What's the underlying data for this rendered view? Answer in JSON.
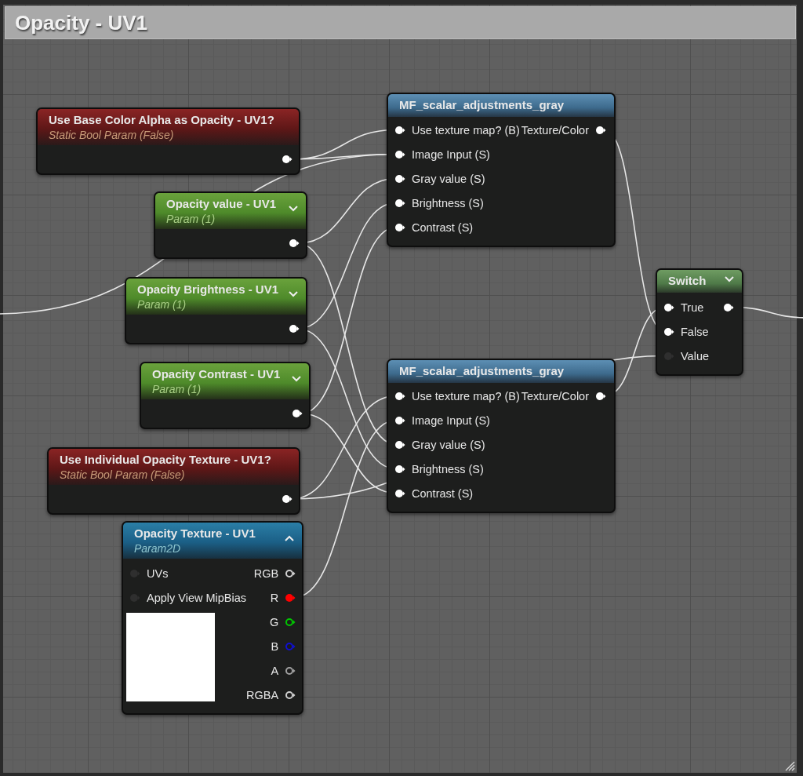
{
  "comment": {
    "title": "Opacity - UV1"
  },
  "nodes": [
    {
      "kind": "static_bool",
      "title": "Use Base Color Alpha as Opacity - UV1?",
      "subtitle": "Static Bool Param (False)",
      "outputs": [
        {
          "connected": true
        }
      ]
    },
    {
      "kind": "scalar",
      "title": "Opacity value - UV1",
      "subtitle": "Param (1)",
      "expanded": false,
      "outputs": [
        {
          "connected": true
        }
      ]
    },
    {
      "kind": "scalar",
      "title": "Opacity Brightness - UV1",
      "subtitle": "Param (1)",
      "expanded": false,
      "outputs": [
        {
          "connected": true
        }
      ]
    },
    {
      "kind": "scalar",
      "title": "Opacity Contrast - UV1",
      "subtitle": "Param (1)",
      "expanded": false,
      "outputs": [
        {
          "connected": true
        }
      ]
    },
    {
      "kind": "static_bool",
      "title": "Use Individual Opacity Texture - UV1?",
      "subtitle": "Static Bool Param (False)",
      "outputs": [
        {
          "connected": true
        }
      ]
    },
    {
      "kind": "texture",
      "title": "Opacity Texture - UV1",
      "subtitle": "Param2D",
      "expanded": true,
      "inputs": [
        {
          "label": "UVs",
          "connected": false
        },
        {
          "label": "Apply View MipBias",
          "connected": false
        }
      ],
      "outputs": [
        {
          "label": "RGB",
          "connected": false,
          "color": "#d0d0d0"
        },
        {
          "label": "R",
          "connected": true,
          "color": "#ff0000"
        },
        {
          "label": "G",
          "connected": false,
          "color": "#00c800"
        },
        {
          "label": "B",
          "connected": false,
          "color": "#1010d0"
        },
        {
          "label": "A",
          "connected": false,
          "color": "#a0a0a0"
        },
        {
          "label": "RGBA",
          "connected": false,
          "color": "#d0d0d0"
        }
      ]
    },
    {
      "kind": "function",
      "title": "MF_scalar_adjustments_gray",
      "inputs": [
        {
          "label": "Use texture map? (B)",
          "connected": true
        },
        {
          "label": "Image Input (S)",
          "connected": true
        },
        {
          "label": "Gray value (S)",
          "connected": true
        },
        {
          "label": "Brightness (S)",
          "connected": true
        },
        {
          "label": "Contrast (S)",
          "connected": true
        }
      ],
      "outputs": [
        {
          "label": "Texture/Color",
          "connected": true
        }
      ]
    },
    {
      "kind": "function",
      "title": "MF_scalar_adjustments_gray",
      "inputs": [
        {
          "label": "Use texture map? (B)",
          "connected": true
        },
        {
          "label": "Image Input (S)",
          "connected": true
        },
        {
          "label": "Gray value (S)",
          "connected": true
        },
        {
          "label": "Brightness (S)",
          "connected": true
        },
        {
          "label": "Contrast (S)",
          "connected": true
        }
      ],
      "outputs": [
        {
          "label": "Texture/Color",
          "connected": true
        }
      ]
    },
    {
      "kind": "switch",
      "title": "Switch",
      "expanded": false,
      "inputs": [
        {
          "label": "True",
          "connected": true
        },
        {
          "label": "False",
          "connected": true
        },
        {
          "label": "Value",
          "connected": false
        }
      ],
      "outputs": [
        {
          "connected": true
        }
      ]
    }
  ]
}
